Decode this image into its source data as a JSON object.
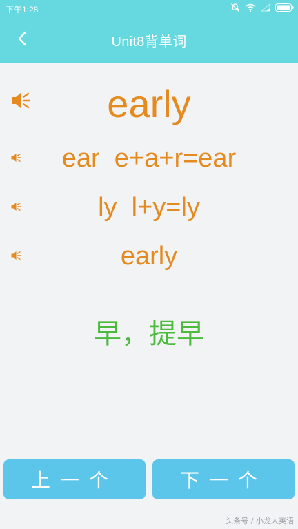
{
  "status_bar": {
    "time": "下午1:28",
    "icons": [
      "mute-icon",
      "wifi-icon",
      "signal-icon",
      "battery-icon"
    ]
  },
  "header": {
    "title": "Unit8背单词",
    "back_icon": "chevron-left-icon",
    "color": "#66d9e0"
  },
  "word": {
    "main": "early",
    "parts": [
      {
        "text": "ear  e+a+r=ear"
      },
      {
        "text": "ly  l+y=ly"
      },
      {
        "text": "early"
      }
    ],
    "meaning": "早，提早",
    "word_color": "#e58a1f",
    "meaning_color": "#4cbb3d"
  },
  "buttons": {
    "prev_label": "上一个",
    "next_label": "下一个",
    "color": "#5cc5ea"
  },
  "watermark": "头条号 / 小龙人英语"
}
